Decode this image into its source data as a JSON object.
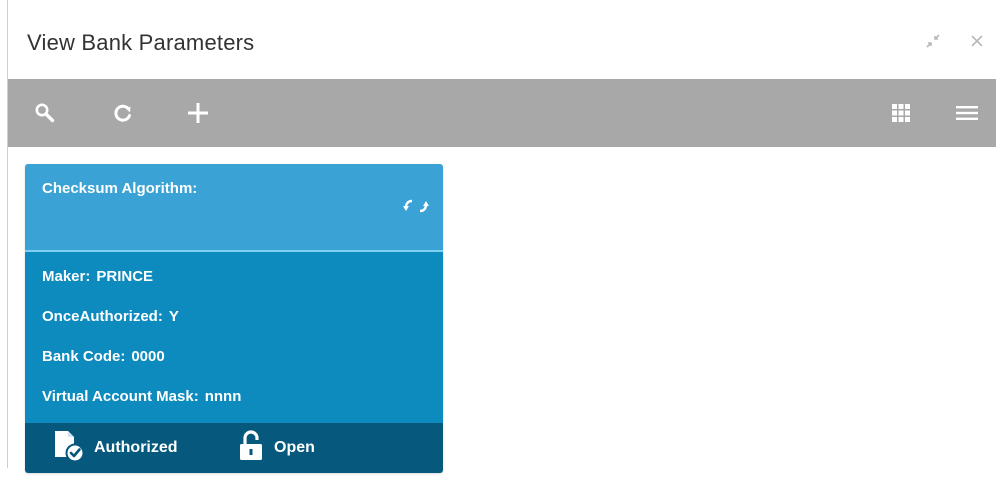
{
  "window": {
    "title": "View Bank Parameters",
    "minimize_icon": "collapse-icon",
    "close_icon": "close-icon"
  },
  "toolbar": {
    "left_buttons": [
      "search-icon",
      "refresh-icon",
      "add-icon"
    ],
    "right_buttons": [
      "grid-view-icon",
      "list-view-icon"
    ],
    "background": "#a8a8a8"
  },
  "card": {
    "header_label": "Checksum Algorithm:",
    "header_value": "",
    "header_icon": "swap-icon",
    "colors": {
      "header": "#3aa2d4",
      "body": "#0d8bbf",
      "footer": "#06587c"
    },
    "fields": {
      "maker": {
        "label": "Maker:",
        "value": "PRINCE"
      },
      "once_authorized": {
        "label": "OnceAuthorized:",
        "value": "Y"
      },
      "bank_code": {
        "label": "Bank Code:",
        "value": "0000"
      },
      "virtual_account_mask": {
        "label": "Virtual Account Mask:",
        "value": "nnnn"
      }
    },
    "footer": {
      "status_label": "Authorized",
      "status_icon": "authorized-document-icon",
      "lock_label": "Open",
      "lock_icon": "unlock-icon"
    }
  }
}
